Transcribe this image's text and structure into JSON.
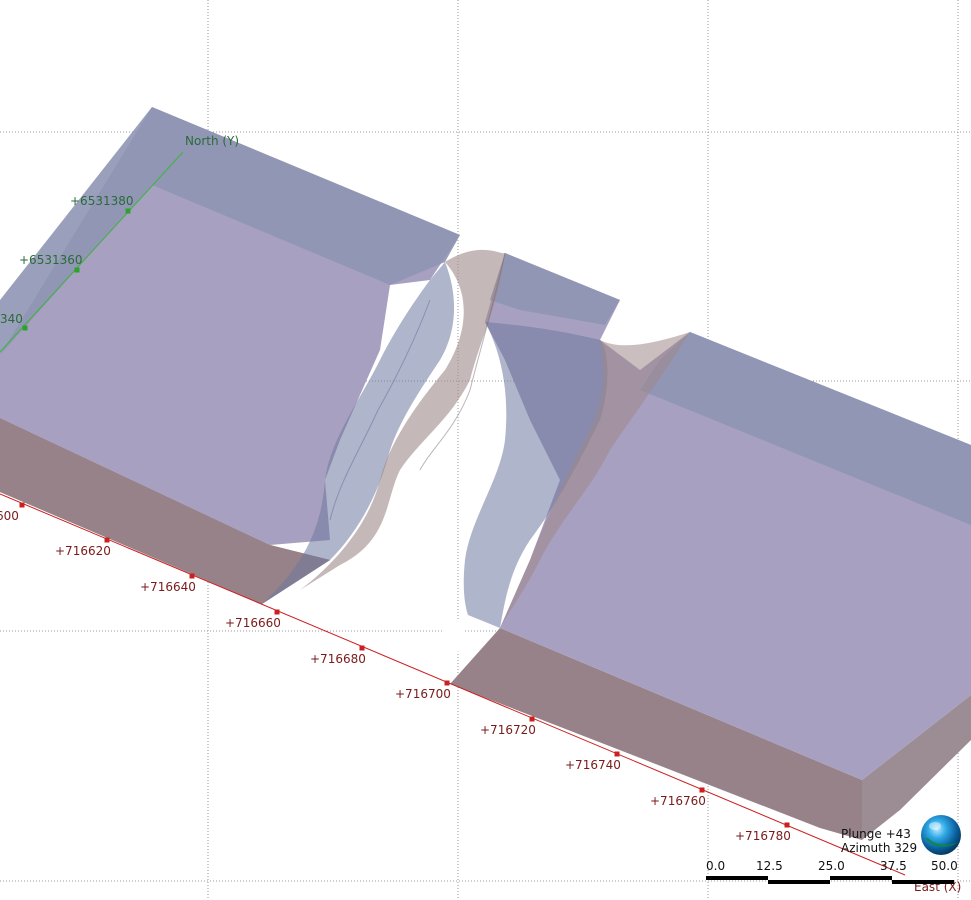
{
  "axes": {
    "east": {
      "title": "East (X)",
      "color": "#cc1f1f",
      "tick_color": "#cc1f1f",
      "label_color": "#7a1a1a",
      "ticks": [
        "600",
        "+716620",
        "+716640",
        "+716660",
        "+716680",
        "+716700",
        "+716720",
        "+716740",
        "+716760",
        "+716780"
      ]
    },
    "north": {
      "title": "North (Y)",
      "color": "#3bb53b",
      "tick_color": "#2da02d",
      "label_color": "#2a6a3a",
      "ticks": [
        "340",
        "+6531360",
        "+6531380"
      ]
    }
  },
  "orientation": {
    "plunge": "Plunge +43",
    "azimuth": "Azimuth 329"
  },
  "scale_bar": {
    "labels": [
      "0.0",
      "12.5",
      "25.0",
      "37.5",
      "50.0"
    ]
  },
  "icons": {
    "orientation_globe": "globe-icon"
  },
  "colors": {
    "block_top": "#8f95b4",
    "block_top_inner": "#a8a0c0",
    "block_side": "#968288",
    "block_side_dark": "#8a7a82",
    "surface_blue": "#6e789e",
    "surface_tan": "#9e8888",
    "background": "#ffffff",
    "grid": "#9a9a9a"
  }
}
